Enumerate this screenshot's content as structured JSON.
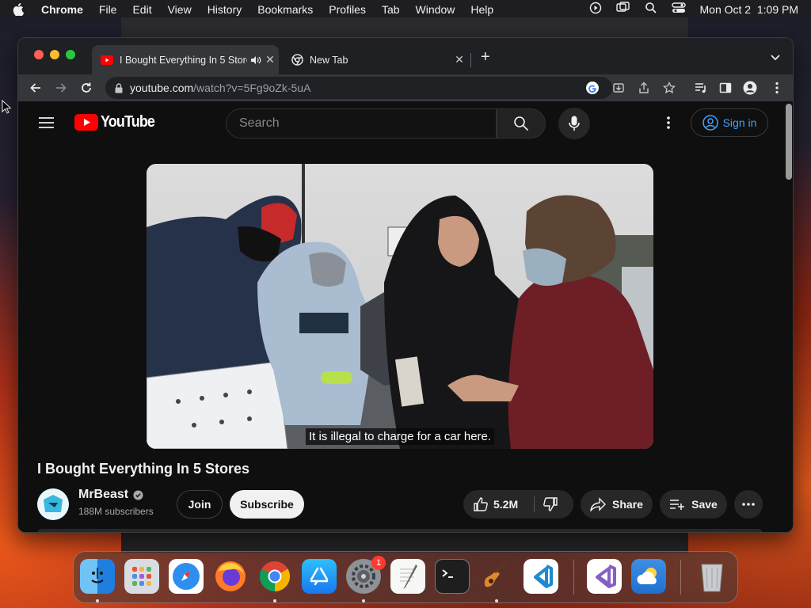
{
  "menubar": {
    "app_name": "Chrome",
    "menus": [
      "File",
      "Edit",
      "View",
      "History",
      "Bookmarks",
      "Profiles",
      "Tab",
      "Window",
      "Help"
    ],
    "datetime": "Mon Oct 2  1:09 PM"
  },
  "browser": {
    "tabs": [
      {
        "title": "I Bought Everything In 5 Stores",
        "active": true,
        "audio": true,
        "favicon": "youtube-icon"
      },
      {
        "title": "New Tab",
        "active": false,
        "favicon": "chrome-icon"
      }
    ],
    "url": {
      "host": "youtube.com",
      "path": "/watch?v=5Fg9oZk-5uA"
    }
  },
  "youtube": {
    "logo_text": "YouTube",
    "search_placeholder": "Search",
    "sign_in_label": "Sign in",
    "caption": "It is illegal to charge for a car here.",
    "video_title": "I Bought Everything In 5 Stores",
    "channel": {
      "name": "MrBeast",
      "subscribers": "188M subscribers",
      "verified": true
    },
    "join_label": "Join",
    "subscribe_label": "Subscribe",
    "likes": "5.2M",
    "share_label": "Share",
    "save_label": "Save"
  },
  "dock": {
    "apps": [
      "Finder",
      "Launchpad",
      "Safari",
      "Firefox",
      "Chrome",
      "App Store",
      "System Settings",
      "TextEdit",
      "Terminal",
      "GarageBand",
      "Visual Studio Code",
      "Visual Studio",
      "Weather",
      "Trash"
    ],
    "settings_badge": "1"
  },
  "colors": {
    "accent_red": "#ff0000",
    "link_blue": "#3ea6ff",
    "page_bg": "#0f0f0f"
  }
}
